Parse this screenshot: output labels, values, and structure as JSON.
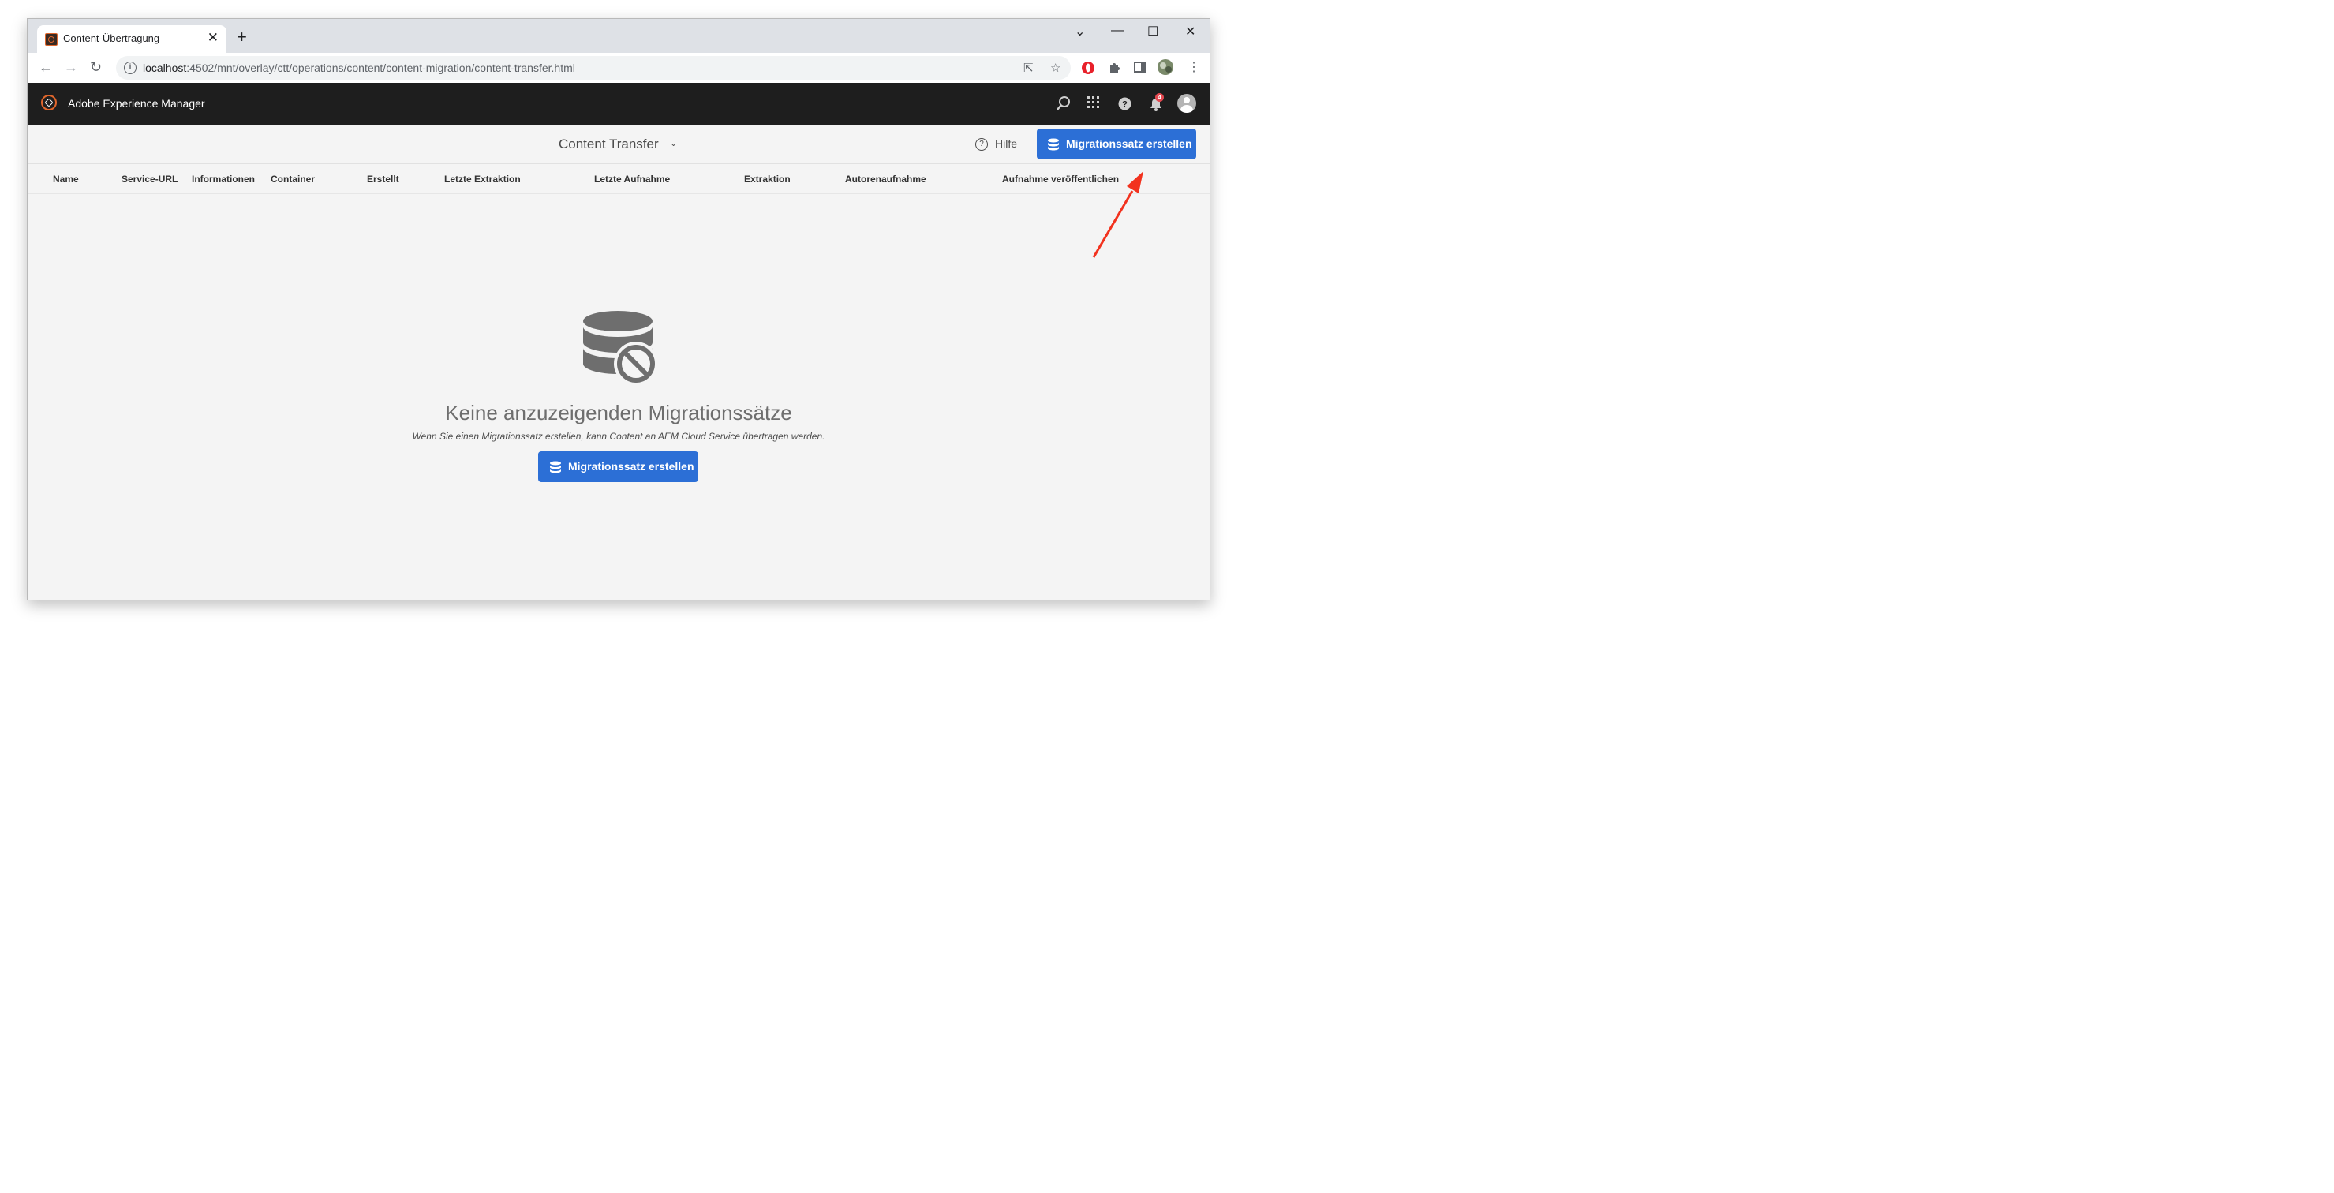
{
  "browser": {
    "tab_title": "Content-Übertragung",
    "tab_close": "✕",
    "new_tab": "+",
    "url_host": "localhost",
    "url_rest": ":4502/mnt/overlay/ctt/operations/content/content-migration/content-transfer.html",
    "window_controls": [
      "⌄",
      "—",
      "☐",
      "✕"
    ]
  },
  "aem": {
    "product_name": "Adobe Experience Manager",
    "notification_count": "4"
  },
  "actionbar": {
    "title": "Content Transfer",
    "help_label": "Hilfe",
    "primary_button": "Migrationssatz erstellen"
  },
  "columns": [
    "Name",
    "Service-URL",
    "Informationen",
    "Container",
    "Erstellt",
    "Letzte Extraktion",
    "Letzte Aufnahme",
    "Extraktion",
    "Autorenaufnahme",
    "Aufnahme veröffentlichen"
  ],
  "empty_state": {
    "title": "Keine anzuzeigenden Migrationssätze",
    "subtitle": "Wenn Sie einen Migrationssatz erstellen, kann Content an AEM Cloud Service übertragen werden.",
    "button": "Migrationssatz erstellen"
  },
  "colors": {
    "primary": "#2c6fd6",
    "header_bg": "#1e1e1e",
    "annotation_arrow": "#f2321e"
  }
}
